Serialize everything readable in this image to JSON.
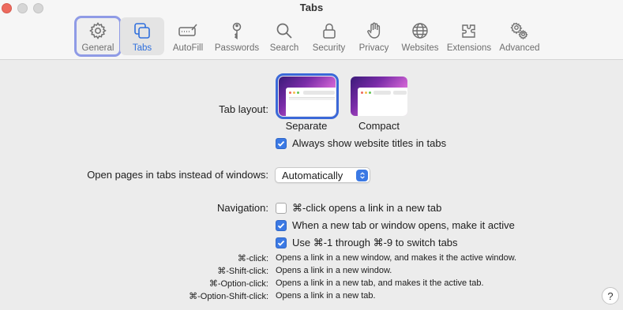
{
  "window": {
    "title": "Tabs"
  },
  "toolbar": {
    "tabs": [
      {
        "label": "General",
        "icon": "gear-icon"
      },
      {
        "label": "Tabs",
        "icon": "tabs-icon"
      },
      {
        "label": "AutoFill",
        "icon": "autofill-icon"
      },
      {
        "label": "Passwords",
        "icon": "key-icon"
      },
      {
        "label": "Search",
        "icon": "search-icon"
      },
      {
        "label": "Security",
        "icon": "lock-icon"
      },
      {
        "label": "Privacy",
        "icon": "hand-icon"
      },
      {
        "label": "Websites",
        "icon": "globe-icon"
      },
      {
        "label": "Extensions",
        "icon": "puzzle-icon"
      },
      {
        "label": "Advanced",
        "icon": "gears-icon"
      }
    ],
    "active_tab": "Tabs",
    "focused_tab": "General"
  },
  "tab_layout": {
    "label": "Tab layout:",
    "options": [
      {
        "caption": "Separate",
        "selected": true
      },
      {
        "caption": "Compact",
        "selected": false
      }
    ],
    "always_show_titles": {
      "label": "Always show website titles in tabs",
      "checked": true
    }
  },
  "open_pages": {
    "label": "Open pages in tabs instead of windows:",
    "value": "Automatically"
  },
  "navigation": {
    "label": "Navigation:",
    "options": [
      {
        "label": "⌘-click opens a link in a new tab",
        "checked": false
      },
      {
        "label": "When a new tab or window opens, make it active",
        "checked": true
      },
      {
        "label": "Use ⌘-1 through ⌘-9 to switch tabs",
        "checked": true
      }
    ]
  },
  "shortcuts": [
    {
      "key": "⌘-click:",
      "desc": "Opens a link in a new window, and makes it the active window."
    },
    {
      "key": "⌘-Shift-click:",
      "desc": "Opens a link in a new window."
    },
    {
      "key": "⌘-Option-click:",
      "desc": "Opens a link in a new tab, and makes it the active tab."
    },
    {
      "key": "⌘-Option-Shift-click:",
      "desc": "Opens a link in a new tab."
    }
  ],
  "help": {
    "label": "?"
  },
  "colors": {
    "accent": "#3b79e4",
    "close": "#ed6a5e",
    "focus_ring": "#8f9be6"
  }
}
